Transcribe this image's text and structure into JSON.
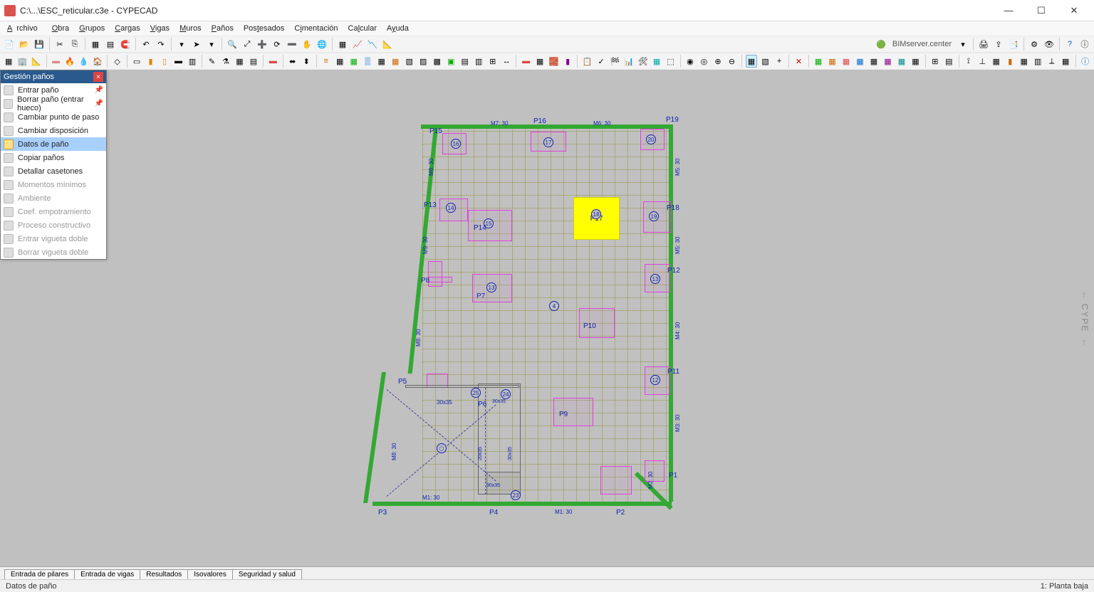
{
  "title": "C:\\...\\ESC_reticular.c3e - CYPECAD",
  "menus": [
    "Archivo",
    "Obra",
    "Grupos",
    "Cargas",
    "Vigas",
    "Muros",
    "Paños",
    "Postesados",
    "Cimentación",
    "Calcular",
    "Ayuda"
  ],
  "bimserver_label": "BIMserver.center",
  "float_panel": {
    "title": "Gestión paños",
    "items": [
      {
        "label": "Entrar paño",
        "disabled": false,
        "pinned": true
      },
      {
        "label": "Borrar paño (entrar hueco)",
        "disabled": false,
        "pinned": true
      },
      {
        "label": "Cambiar punto de paso",
        "disabled": false
      },
      {
        "label": "Cambiar disposición",
        "disabled": false
      },
      {
        "label": "Datos de paño",
        "disabled": false,
        "selected": true
      },
      {
        "label": "Copiar paños",
        "disabled": false
      },
      {
        "label": "Detallar casetones",
        "disabled": false
      },
      {
        "label": "Momentos mínimos",
        "disabled": true
      },
      {
        "label": "Ambiente",
        "disabled": true
      },
      {
        "label": "Coef. empotramiento",
        "disabled": true
      },
      {
        "label": "Proceso constructivo",
        "disabled": true
      },
      {
        "label": "Entrar vigueta doble",
        "disabled": true
      },
      {
        "label": "Borrar vigueta doble",
        "disabled": true
      }
    ]
  },
  "bottom_tabs": [
    "Entrada de pilares",
    "Entrada de vigas",
    "Resultados",
    "Isovalores",
    "Seguridad y salud"
  ],
  "status_left": "Datos de paño",
  "status_right": "1: Planta baja",
  "cype_label": "CYPE",
  "plan": {
    "pillars": [
      "P1",
      "P2",
      "P3",
      "P4",
      "P5",
      "P6",
      "P7",
      "P8",
      "P9",
      "P10",
      "P11",
      "P12",
      "P13",
      "P14",
      "P15",
      "P16",
      "P17",
      "P18",
      "P19"
    ],
    "beams_h": [
      "M1: 30",
      "M6: 30",
      "M7: 30",
      "30x35"
    ],
    "beams_v": [
      "M2: 30",
      "M3: 30",
      "M4: 30",
      "M5: 30",
      "M8: 30",
      "M9: 30",
      "20x35",
      "30x35"
    ],
    "highlight_label": "P17",
    "nodes": [
      "4",
      "12",
      "13",
      "14",
      "15",
      "16",
      "17",
      "18",
      "19",
      "20",
      "23",
      "24",
      "25"
    ]
  }
}
